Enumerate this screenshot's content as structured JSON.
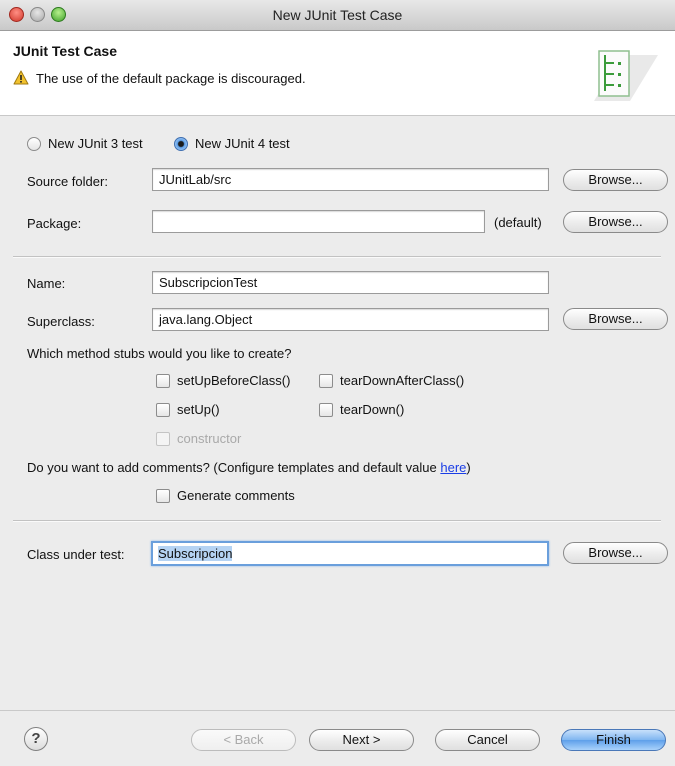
{
  "window": {
    "title": "New JUnit Test Case"
  },
  "header": {
    "title": "JUnit Test Case",
    "message": "The use of the default package is discouraged.",
    "message_icon": "warning-icon",
    "banner_icon": "junit-wizard-banner-icon"
  },
  "version": {
    "options": [
      "New JUnit 3 test",
      "New JUnit 4 test"
    ],
    "selected": "New JUnit 4 test"
  },
  "source_folder": {
    "label": "Source folder:",
    "value": "JUnitLab/src",
    "browse": "Browse..."
  },
  "package": {
    "label": "Package:",
    "value": "",
    "suffix": "(default)",
    "browse": "Browse..."
  },
  "name": {
    "label": "Name:",
    "value": "SubscripcionTest"
  },
  "superclass": {
    "label": "Superclass:",
    "value": "java.lang.Object",
    "browse": "Browse..."
  },
  "stubs": {
    "question": "Which method stubs would you like to create?",
    "items": [
      {
        "label": "setUpBeforeClass()",
        "checked": false,
        "enabled": true
      },
      {
        "label": "tearDownAfterClass()",
        "checked": false,
        "enabled": true
      },
      {
        "label": "setUp()",
        "checked": false,
        "enabled": true
      },
      {
        "label": "tearDown()",
        "checked": false,
        "enabled": true
      },
      {
        "label": "constructor",
        "checked": false,
        "enabled": false
      }
    ]
  },
  "comments": {
    "question": "Do you want to add comments? (Configure templates and default value ",
    "link": "here",
    "close": ")",
    "generate_label": "Generate comments",
    "checked": false
  },
  "class_under_test": {
    "label": "Class under test:",
    "value": "Subscripcion",
    "browse": "Browse..."
  },
  "footer": {
    "help": "?",
    "back": "< Back",
    "next": "Next >",
    "cancel": "Cancel",
    "finish": "Finish"
  },
  "colors": {
    "focus_ring": "#6a9fdc",
    "link": "#1a3de6",
    "default_button": "#5e9fea"
  }
}
